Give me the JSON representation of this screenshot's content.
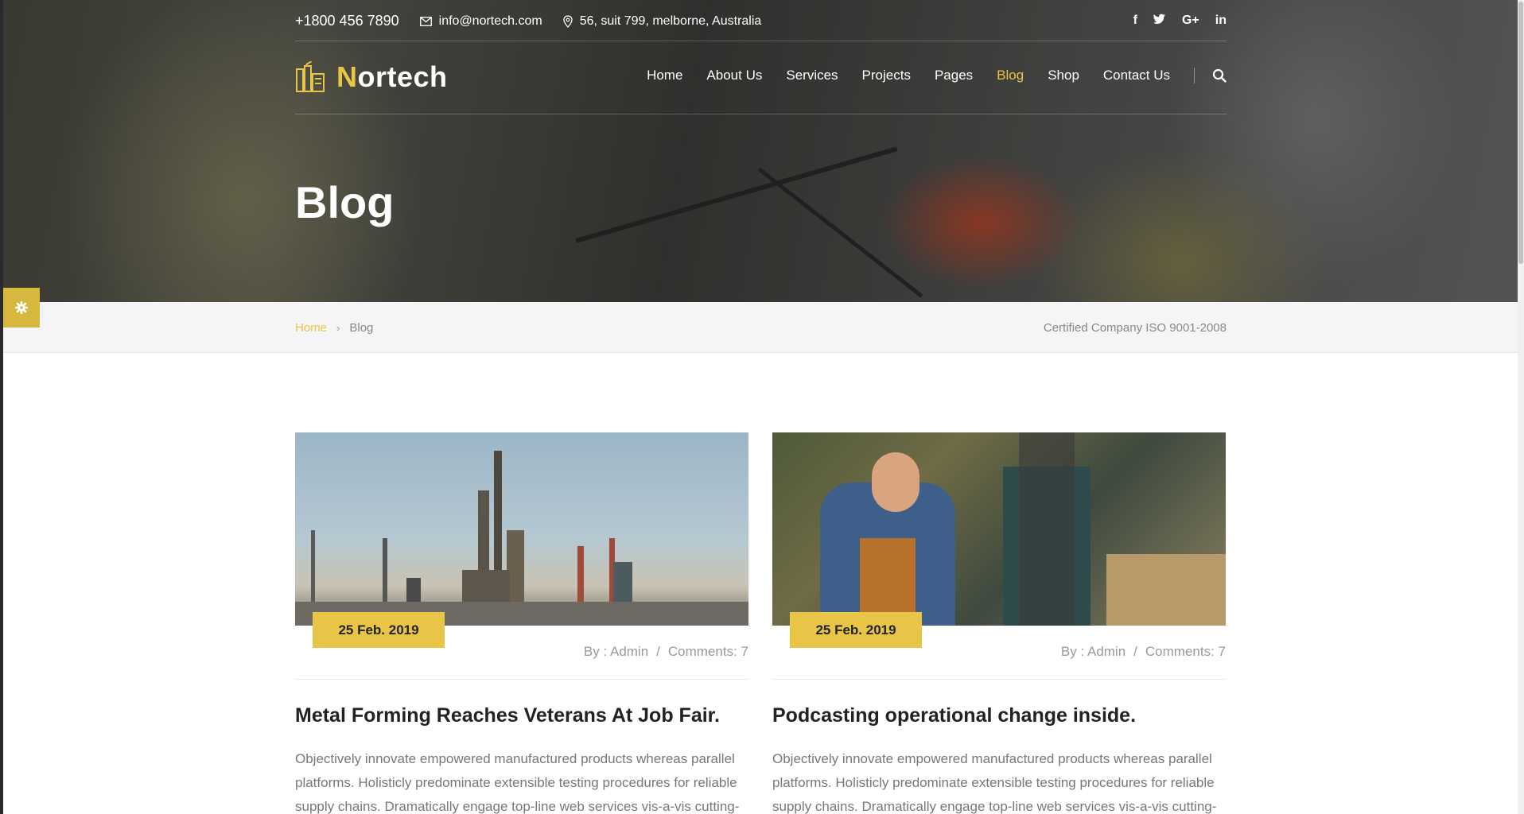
{
  "topbar": {
    "phone": "+1800 456 7890",
    "email": "info@nortech.com",
    "address": "56, suit 799, melborne, Australia",
    "social": {
      "facebook": "f",
      "twitter": "twitter-icon",
      "googleplus": "G+",
      "linkedin": "in"
    }
  },
  "header": {
    "logo_text": "ortech",
    "logo_initial": "N",
    "nav": [
      {
        "label": "Home"
      },
      {
        "label": "About Us"
      },
      {
        "label": "Services"
      },
      {
        "label": "Projects"
      },
      {
        "label": "Pages"
      },
      {
        "label": "Blog",
        "active": true
      },
      {
        "label": "Shop"
      },
      {
        "label": "Contact Us"
      }
    ],
    "search_icon": "search-icon"
  },
  "hero": {
    "title": "Blog"
  },
  "breadcrumb": {
    "home": "Home",
    "current": "Blog",
    "note": "Certified Company ISO 9001-2008"
  },
  "settings_tab": {
    "icon": "gear-icon"
  },
  "posts": [
    {
      "date": "25 Feb. 2019",
      "author": "By : Admin",
      "separator": "/",
      "comments": "Comments: 7",
      "title": "Metal Forming Reaches Veterans At Job Fair.",
      "excerpt": "Objectively innovate empowered manufactured products whereas parallel platforms. Holisticly predominate extensible testing procedures for reliable supply chains. Dramatically engage top-line web services vis-a-vis cutting-"
    },
    {
      "date": "25 Feb. 2019",
      "author": "By : Admin",
      "separator": "/",
      "comments": "Comments: 7",
      "title": "Podcasting operational change inside.",
      "excerpt": "Objectively innovate empowered manufactured products whereas parallel platforms. Holisticly predominate extensible testing procedures for reliable supply chains. Dramatically engage top-line web services vis-a-vis cutting-"
    }
  ],
  "colors": {
    "accent": "#e8c547",
    "text": "#222222",
    "muted": "#777777"
  }
}
